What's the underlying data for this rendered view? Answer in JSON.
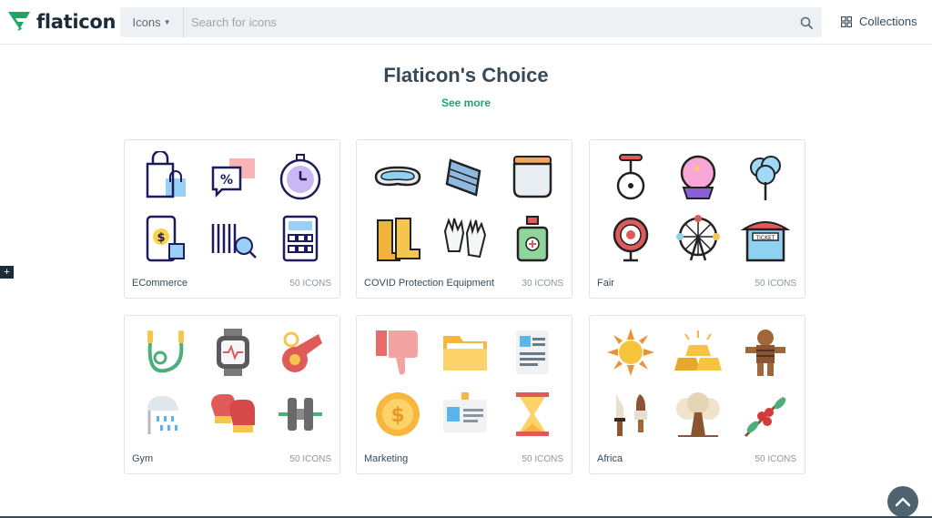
{
  "header": {
    "logo_text": "flaticon",
    "search_type": "Icons",
    "search_placeholder": "Search for icons",
    "collections_label": "Collections"
  },
  "section": {
    "title": "Flaticon's Choice",
    "see_more": "See more"
  },
  "packs": [
    {
      "name": "ECommerce",
      "count": "50 ICONS"
    },
    {
      "name": "COVID Protection Equipment",
      "count": "30 ICONS"
    },
    {
      "name": "Fair",
      "count": "50 ICONS"
    },
    {
      "name": "Gym",
      "count": "50 ICONS"
    },
    {
      "name": "Marketing",
      "count": "50 ICONS"
    },
    {
      "name": "Africa",
      "count": "50 ICONS"
    }
  ],
  "side_button": "+",
  "colors": {
    "brand_green": "#1ea664",
    "dark_navy": "#1b2b37",
    "search_bg": "#eef1f3"
  }
}
